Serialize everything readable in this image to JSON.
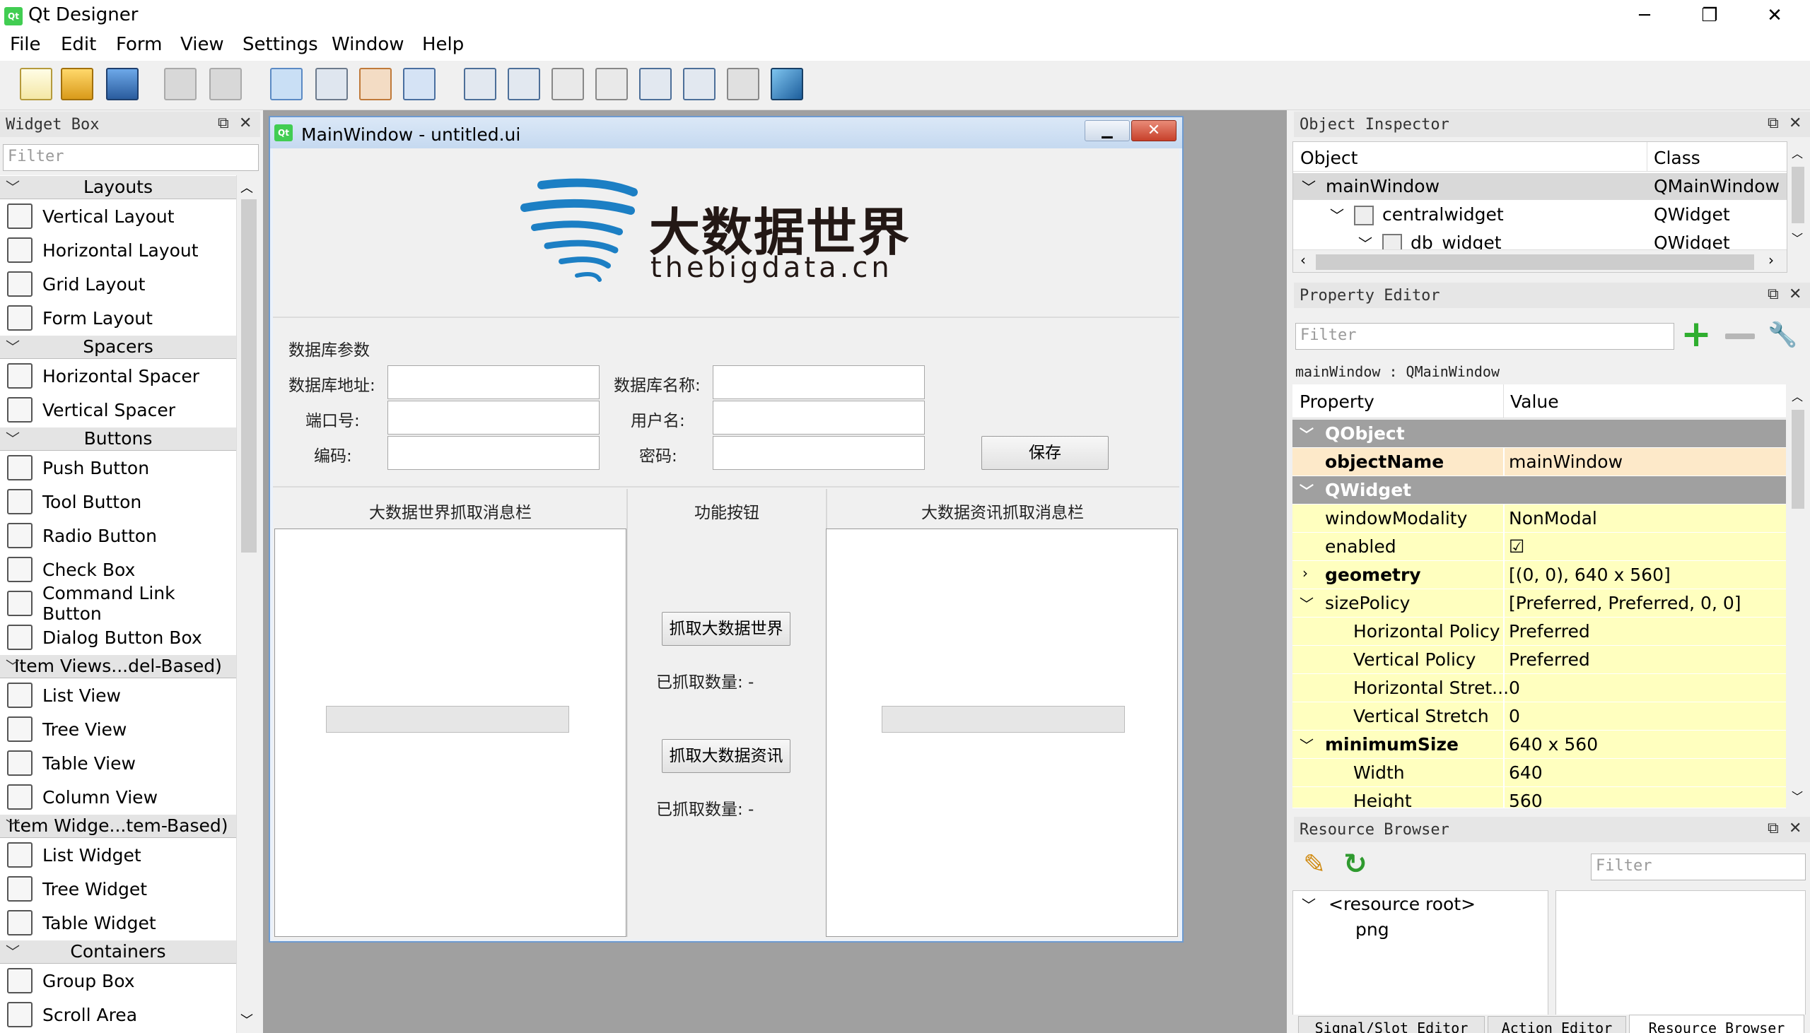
{
  "window": {
    "title": "Qt Designer",
    "icon": "Qt"
  },
  "menu": [
    "File",
    "Edit",
    "Form",
    "View",
    "Settings",
    "Window",
    "Help"
  ],
  "widget_box": {
    "title": "Widget Box",
    "filter_placeholder": "Filter",
    "categories": [
      {
        "name": "Layouts",
        "items": [
          "Vertical Layout",
          "Horizontal Layout",
          "Grid Layout",
          "Form Layout"
        ]
      },
      {
        "name": "Spacers",
        "items": [
          "Horizontal Spacer",
          "Vertical Spacer"
        ]
      },
      {
        "name": "Buttons",
        "items": [
          "Push Button",
          "Tool Button",
          "Radio Button",
          "Check Box",
          "Command Link Button",
          "Dialog Button Box"
        ]
      },
      {
        "name": "Item Views...del-Based)",
        "items": [
          "List View",
          "Tree View",
          "Table View",
          "Column View"
        ]
      },
      {
        "name": "Item Widge...tem-Based)",
        "items": [
          "List Widget",
          "Tree Widget",
          "Table Widget"
        ]
      },
      {
        "name": "Containers",
        "items": [
          "Group Box",
          "Scroll Area"
        ]
      }
    ]
  },
  "form": {
    "title": "MainWindow - untitled.ui",
    "icon": "Qt",
    "logo_cn": "大数据世界",
    "logo_en": "thebigdata.cn",
    "db_group_label": "数据库参数",
    "db_address_label": "数据库地址:",
    "db_name_label": "数据库名称:",
    "port_label": "端口号:",
    "username_label": "用户名:",
    "encoding_label": "编码:",
    "password_label": "密码:",
    "save_label": "保存",
    "col1_header": "大数据世界抓取消息栏",
    "col2_header": "功能按钮",
    "col3_header": "大数据资讯抓取消息栏",
    "fetch_world_label": "抓取大数据世界",
    "fetched_count_1": "已抓取数量: -",
    "fetch_news_label": "抓取大数据资讯",
    "fetched_count_2": "已抓取数量: -"
  },
  "object_inspector": {
    "title": "Object Inspector",
    "columns": [
      "Object",
      "Class"
    ],
    "rows": [
      {
        "object": "mainWindow",
        "class": "QMainWindow"
      },
      {
        "object": "centralwidget",
        "class": "QWidget"
      },
      {
        "object": "db_widget",
        "class": "QWidget"
      }
    ]
  },
  "property_editor": {
    "title": "Property Editor",
    "filter_placeholder": "Filter",
    "context": "mainWindow : QMainWindow",
    "columns": [
      "Property",
      "Value"
    ],
    "sections": [
      "QObject",
      "QWidget"
    ],
    "rows": [
      {
        "key": "objectName",
        "value": "mainWindow"
      },
      {
        "key": "windowModality",
        "value": "NonModal"
      },
      {
        "key": "enabled",
        "value": "☑"
      },
      {
        "key": "geometry",
        "value": "[(0, 0), 640 x 560]"
      },
      {
        "key": "sizePolicy",
        "value": "[Preferred, Preferred, 0, 0]"
      },
      {
        "key": "Horizontal Policy",
        "value": "Preferred"
      },
      {
        "key": "Vertical Policy",
        "value": "Preferred"
      },
      {
        "key": "Horizontal Stret...",
        "value": "0"
      },
      {
        "key": "Vertical Stretch",
        "value": "0"
      },
      {
        "key": "minimumSize",
        "value": "640 x 560"
      },
      {
        "key": "Width",
        "value": "640"
      },
      {
        "key": "Height",
        "value": "560"
      }
    ]
  },
  "resource_browser": {
    "title": "Resource Browser",
    "filter_placeholder": "Filter",
    "tree": [
      "<resource root>",
      "png"
    ]
  },
  "bottom_tabs": [
    "Signal/Slot Editor",
    "Action Editor",
    "Resource Browser"
  ],
  "colors": {
    "accent": "#41cd52",
    "section_bg": "#a0a0a0",
    "prop_bg": "#ffffbf",
    "prop_highlight": "#fde9c9"
  }
}
